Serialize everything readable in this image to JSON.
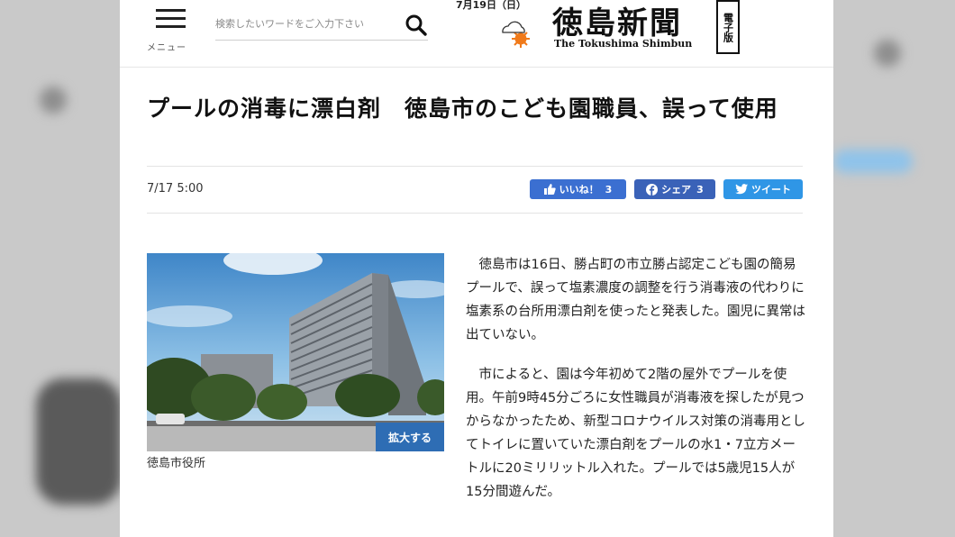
{
  "header": {
    "menu_label": "メニュー",
    "search_placeholder": "検索したいワードをご入力下さい",
    "date": "7月19日（日）",
    "logo_jp": "徳島新聞",
    "logo_en": "The Tokushima Shimbun",
    "edition_badge": "電子版"
  },
  "article": {
    "title": "プールの消毒に漂白剤　徳島市のこども園職員、誤って使用",
    "timestamp": "7/17 5:00",
    "share": {
      "like_label": "いいね！",
      "like_count": "3",
      "facebook_label": "シェア",
      "facebook_count": "3",
      "tweet_label": "ツイート"
    },
    "photo": {
      "enlarge_label": "拡大する",
      "caption": "徳島市役所"
    },
    "paragraphs": [
      "徳島市は16日、勝占町の市立勝占認定こども園の簡易プールで、誤って塩素濃度の調整を行う消毒液の代わりに塩素系の台所用漂白剤を使ったと発表した。園児に異常は出ていない。",
      "市によると、園は今年初めて2階の屋外でプールを使用。午前9時45分ごろに女性職員が消毒液を探したが見つからなかったため、新型コロナウイルス対策の消毒用としてトイレに置いていた漂白剤をプールの水1・7立方メートルに20ミリリットル入れた。プールでは5歳児15人が15分間遊んだ。"
    ]
  },
  "colors": {
    "like_button": "#3b6fd1",
    "facebook_button": "#3a62b8",
    "twitter_button": "#2f96e6",
    "enlarge_button": "#2e6db4",
    "sun": "#f07a1a"
  },
  "icons": [
    "hamburger-menu-icon",
    "search-icon",
    "weather-cloudy-sunny-icon",
    "thumbs-up-icon",
    "facebook-icon",
    "twitter-icon"
  ]
}
